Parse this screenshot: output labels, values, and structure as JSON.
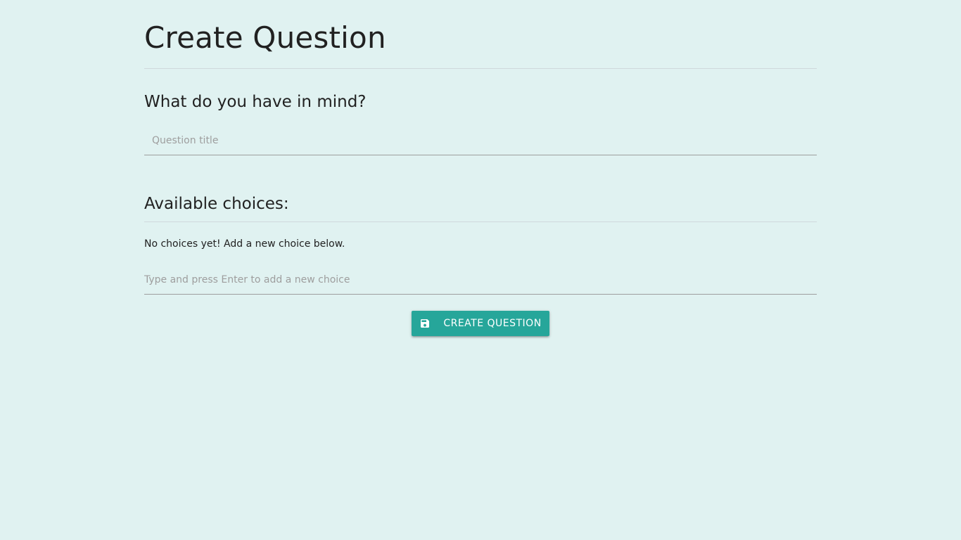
{
  "page": {
    "title": "Create Question"
  },
  "question": {
    "heading": "What do you have in mind?",
    "title_placeholder": "Question title",
    "title_value": ""
  },
  "choices": {
    "heading": "Available choices:",
    "empty_message": "No choices yet! Add a new choice below.",
    "new_choice_placeholder": "Type and press Enter to add a new choice",
    "new_choice_value": ""
  },
  "actions": {
    "create_label": "Create Question",
    "create_icon": "save-icon"
  },
  "colors": {
    "background": "#e0f2f1",
    "accent": "#26a69a",
    "text": "#212121",
    "placeholder": "#9e9e9e"
  }
}
